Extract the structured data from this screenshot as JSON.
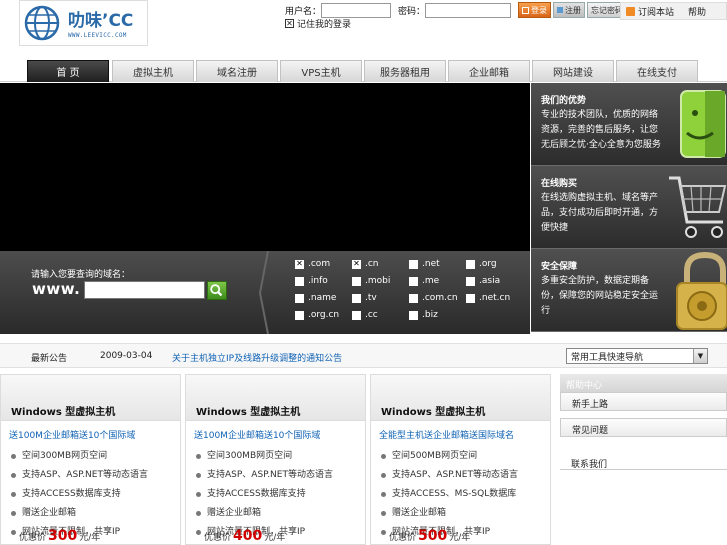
{
  "logo": {
    "brand": "叻味’CC",
    "url": "WWW.LEEVICC.COM"
  },
  "login": {
    "user_label": "用户名：",
    "pass_label": "密码：",
    "login_button": "登录",
    "register_button": "注册",
    "forgot_button": "忘记密码",
    "remember_label": "记住我的登录"
  },
  "toplinks": {
    "rss": "订阅本站",
    "help": "帮助"
  },
  "nav": {
    "tabs": [
      "首 页",
      "虚拟主机",
      "域名注册",
      "VPS主机",
      "服务器租用",
      "企业邮箱",
      "网站建设",
      "在线支付"
    ]
  },
  "features": [
    {
      "title": "我们的优势",
      "desc": "专业的技术团队，优质的网络资源，完善的售后服务，让您无后顾之忧·全心全意为您服务"
    },
    {
      "title": "在线购买",
      "desc": "在线选购虚拟主机、域名等产品，支付成功后即时开通，方便快捷"
    },
    {
      "title": "安全保障",
      "desc": "多重安全防护，数据定期备份，保障您的网站稳定安全运行"
    }
  ],
  "domain": {
    "caption": "请输入您要查询的域名：",
    "prefix": "www.",
    "input_value": "",
    "tlds": [
      {
        "label": ".com",
        "checked": true
      },
      {
        "label": ".cn",
        "checked": true
      },
      {
        "label": ".net",
        "checked": false
      },
      {
        "label": ".org",
        "checked": false
      },
      {
        "label": ".info",
        "checked": false
      },
      {
        "label": ".mobi",
        "checked": false
      },
      {
        "label": ".me",
        "checked": false
      },
      {
        "label": ".asia",
        "checked": false
      },
      {
        "label": ".name",
        "checked": false
      },
      {
        "label": ".tv",
        "checked": false
      },
      {
        "label": ".com.cn",
        "checked": false
      },
      {
        "label": ".net.cn",
        "checked": false
      },
      {
        "label": ".org.cn",
        "checked": false
      },
      {
        "label": ".cc",
        "checked": false
      },
      {
        "label": ".biz",
        "checked": false
      }
    ]
  },
  "news": {
    "label": "最新公告",
    "date": "2009-03-04",
    "headline": "关于主机独立IP及线路升级调整的通知公告",
    "select_value": "常用工具快速导航"
  },
  "cards": [
    {
      "title": "Windows 型虚拟主机",
      "promo": "送100M企业邮箱送10个国际域",
      "features": [
        "空间300MB网页空间",
        "支持ASP、ASP.NET等动态语言",
        "支持ACCESS数据库支持",
        "赠送企业邮箱",
        "网站流量不限制，共享IP"
      ],
      "price_prefix": "优惠价",
      "price": "300",
      "price_suffix": "元/年"
    },
    {
      "title": "Windows 型虚拟主机",
      "promo": "送100M企业邮箱送10个国际域",
      "features": [
        "空间300MB网页空间",
        "支持ASP、ASP.NET等动态语言",
        "支持ACCESS数据库支持",
        "赠送企业邮箱",
        "网站流量不限制，共享IP"
      ],
      "price_prefix": "优惠价",
      "price": "400",
      "price_suffix": "元/年"
    },
    {
      "title": "Windows 型虚拟主机",
      "promo": "全能型主机送企业邮箱送国际域名",
      "features": [
        "空间500MB网页空间",
        "支持ASP、ASP.NET等动态语言",
        "支持ACCESS、MS-SQL数据库",
        "赠送企业邮箱",
        "网站流量不限制，共享IP"
      ],
      "price_prefix": "优惠价",
      "price": "500",
      "price_suffix": "元/年"
    }
  ],
  "side": {
    "header": "帮助中心",
    "items": [
      "新手上路",
      "常见问题",
      "联系我们"
    ]
  },
  "colors": {
    "accent_blue": "#1063b5",
    "price_red": "#d10000",
    "banner": "#000000"
  }
}
